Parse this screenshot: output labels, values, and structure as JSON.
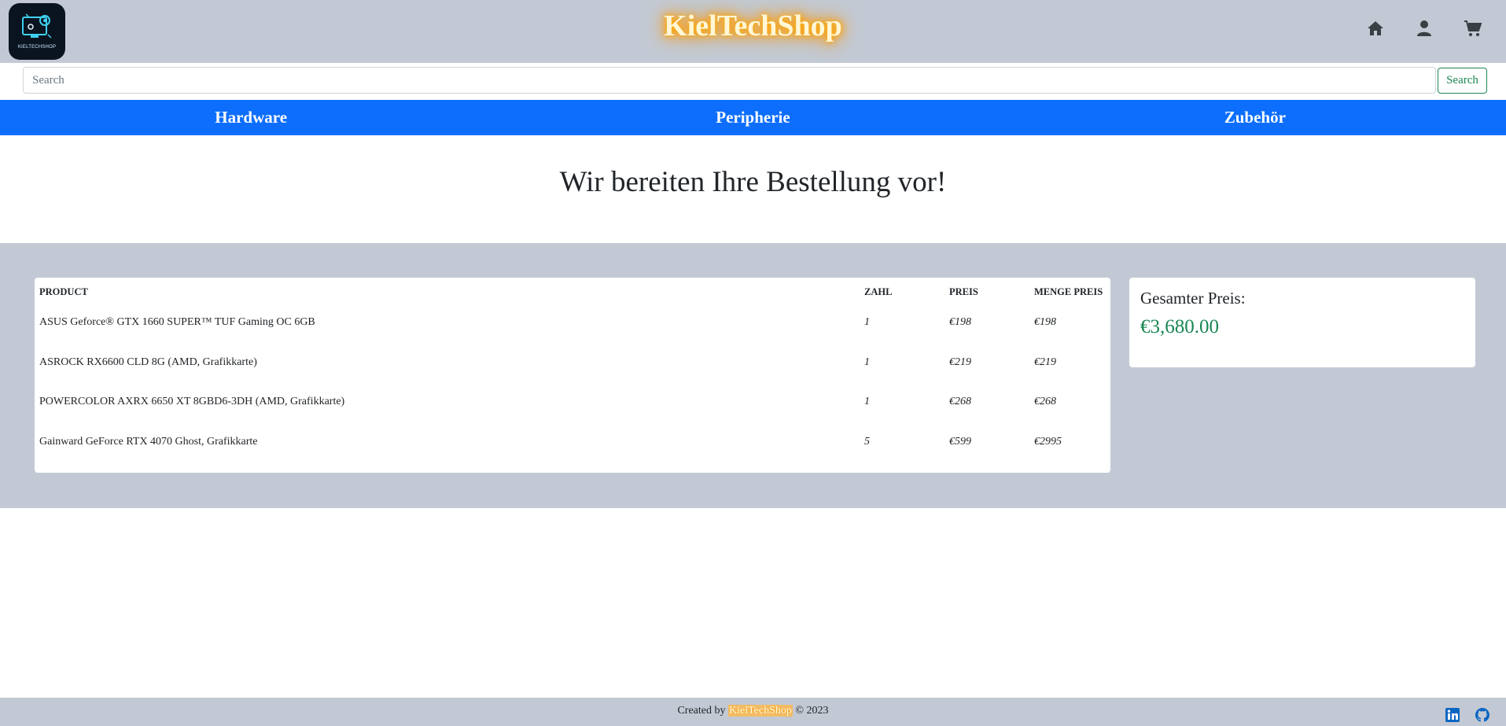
{
  "header": {
    "logo_text": "KIELTECHSHOP",
    "title": "KielTechShop",
    "icons": [
      "home-icon",
      "user-icon",
      "cart-icon"
    ]
  },
  "search": {
    "placeholder": "Search",
    "value": "",
    "button_label": "Search"
  },
  "nav": {
    "items": [
      {
        "label": "Hardware"
      },
      {
        "label": "Peripherie"
      },
      {
        "label": "Zubehör"
      }
    ]
  },
  "main": {
    "headline": "Wir bereiten Ihre Bestellung vor!"
  },
  "order_table": {
    "columns": [
      "PRODUCT",
      "ZAHL",
      "PREIS",
      "MENGE PREIS"
    ],
    "rows": [
      {
        "product": "ASUS Geforce® GTX 1660 SUPER™ TUF Gaming OC 6GB",
        "zahl": "1",
        "preis": "€198",
        "menge_preis": "€198"
      },
      {
        "product": "ASROCK RX6600 CLD 8G (AMD, Grafikkarte)",
        "zahl": "1",
        "preis": "€219",
        "menge_preis": "€219"
      },
      {
        "product": "POWERCOLOR AXRX 6650 XT 8GBD6-3DH (AMD, Grafikkarte)",
        "zahl": "1",
        "preis": "€268",
        "menge_preis": "€268"
      },
      {
        "product": "Gainward GeForce RTX 4070 Ghost, Grafikkarte",
        "zahl": "5",
        "preis": "€599",
        "menge_preis": "€2995"
      }
    ]
  },
  "summary": {
    "label": "Gesamter Preis:",
    "total": "€3,680.00"
  },
  "footer": {
    "prefix": "Created by",
    "brand": "KielTechShop",
    "suffix": "© 2023",
    "icons": [
      "linkedin-icon",
      "github-icon"
    ]
  },
  "colors": {
    "header_bg": "#c3c9d4",
    "nav_bg": "#0d6efd",
    "accent_green": "#198754",
    "title_glow": "#ff9a00"
  }
}
